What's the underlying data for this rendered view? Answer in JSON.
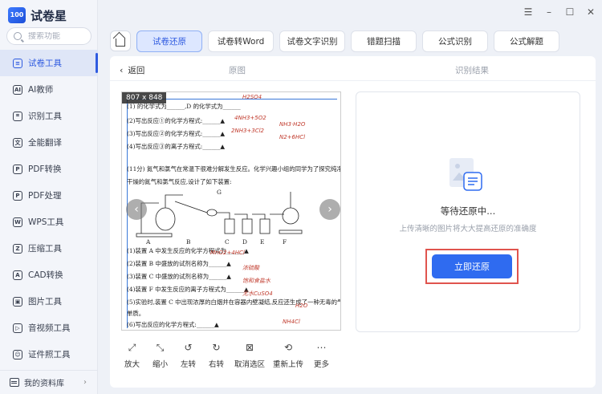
{
  "app": {
    "logo_badge": "100",
    "title": "试卷星"
  },
  "search": {
    "placeholder": "搜索功能"
  },
  "sidebar": {
    "items": [
      {
        "label": "试卷工具",
        "icon": "layers-icon",
        "active": true
      },
      {
        "label": "AI教师",
        "icon": "ai-teacher-icon"
      },
      {
        "label": "识别工具",
        "icon": "scan-icon"
      },
      {
        "label": "全能翻译",
        "icon": "translate-icon"
      },
      {
        "label": "PDF转换",
        "icon": "pdf-convert-icon"
      },
      {
        "label": "PDF处理",
        "icon": "pdf-process-icon"
      },
      {
        "label": "WPS工具",
        "icon": "wps-icon"
      },
      {
        "label": "压缩工具",
        "icon": "compress-icon"
      },
      {
        "label": "CAD转换",
        "icon": "cad-icon"
      },
      {
        "label": "图片工具",
        "icon": "image-icon"
      },
      {
        "label": "音视频工具",
        "icon": "media-icon"
      },
      {
        "label": "证件照工具",
        "icon": "id-photo-icon"
      }
    ],
    "footer": "我的资料库"
  },
  "tabs": [
    {
      "label": "试卷还原",
      "active": true
    },
    {
      "label": "试卷转Word"
    },
    {
      "label": "试卷文字识别"
    },
    {
      "label": "错题扫描"
    },
    {
      "label": "公式识别"
    },
    {
      "label": "公式解题"
    }
  ],
  "main": {
    "back_label": "返回",
    "original_label": "原图",
    "result_label": "识别结果"
  },
  "document": {
    "size": "807 x 848",
    "lines": [
      "(1) 的化学式为______,D 的化学式为______",
      "(2)写出反应①的化学方程式:______▲",
      "(3)写出反应②的化学方程式:______▲",
      "(4)写出反应③的离子方程式:______▲",
      "(11分) 氮气和氯气在常温下很难分解发生反应。化学兴趣小组的同学为了探究纯净、",
      "干燥的氮气和氯气反应,设计了如下装置:",
      "(1)装置 A 中发生反应的化学方程式为______▲",
      "(2)装置 B 中盛放的试剂名称为______▲",
      "(3)装置 C 中盛放的试剂名称为______▲",
      "(4)装置 F 中发生反应的离子方程式为______▲",
      "(5)实验时,装置 C 中出现浓厚的白烟并在容器内壁凝结,反应还生成了一种无毒的气态",
      "单质。",
      "(6)写出反应的化学方程式:______▲"
    ],
    "apparatus_labels": [
      "A",
      "B",
      "C",
      "D",
      "E",
      "F",
      "G"
    ],
    "handwriting": [
      "H2SO4",
      "4NH3+5O2",
      "NH3·H2O",
      "2NH3+3Cl2",
      "N2+6HCl",
      "MnO2+4HCl",
      "浓硫酸",
      "饱和食盐水",
      "无水CuSO4",
      "H2O",
      "NH4Cl"
    ]
  },
  "toolbar": [
    {
      "label": "放大",
      "icon": "zoom-in-icon",
      "glyph": "⤢"
    },
    {
      "label": "缩小",
      "icon": "zoom-out-icon",
      "glyph": "⤡"
    },
    {
      "label": "左转",
      "icon": "rotate-left-icon",
      "glyph": "↺"
    },
    {
      "label": "右转",
      "icon": "rotate-right-icon",
      "glyph": "↻"
    },
    {
      "label": "取消选区",
      "icon": "clear-selection-icon",
      "glyph": "⊠"
    },
    {
      "label": "重新上传",
      "icon": "reupload-icon",
      "glyph": "⟲"
    },
    {
      "label": "更多",
      "icon": "more-icon",
      "glyph": "⋯"
    }
  ],
  "result": {
    "status": "等待还原中...",
    "hint": "上传清晰的图片将大大提高还原的准确度",
    "button_label": "立即还原"
  },
  "colors": {
    "accent": "#2f6bf0",
    "highlight_border": "#e0544e",
    "active_tab_bg": "#dde7ff"
  }
}
